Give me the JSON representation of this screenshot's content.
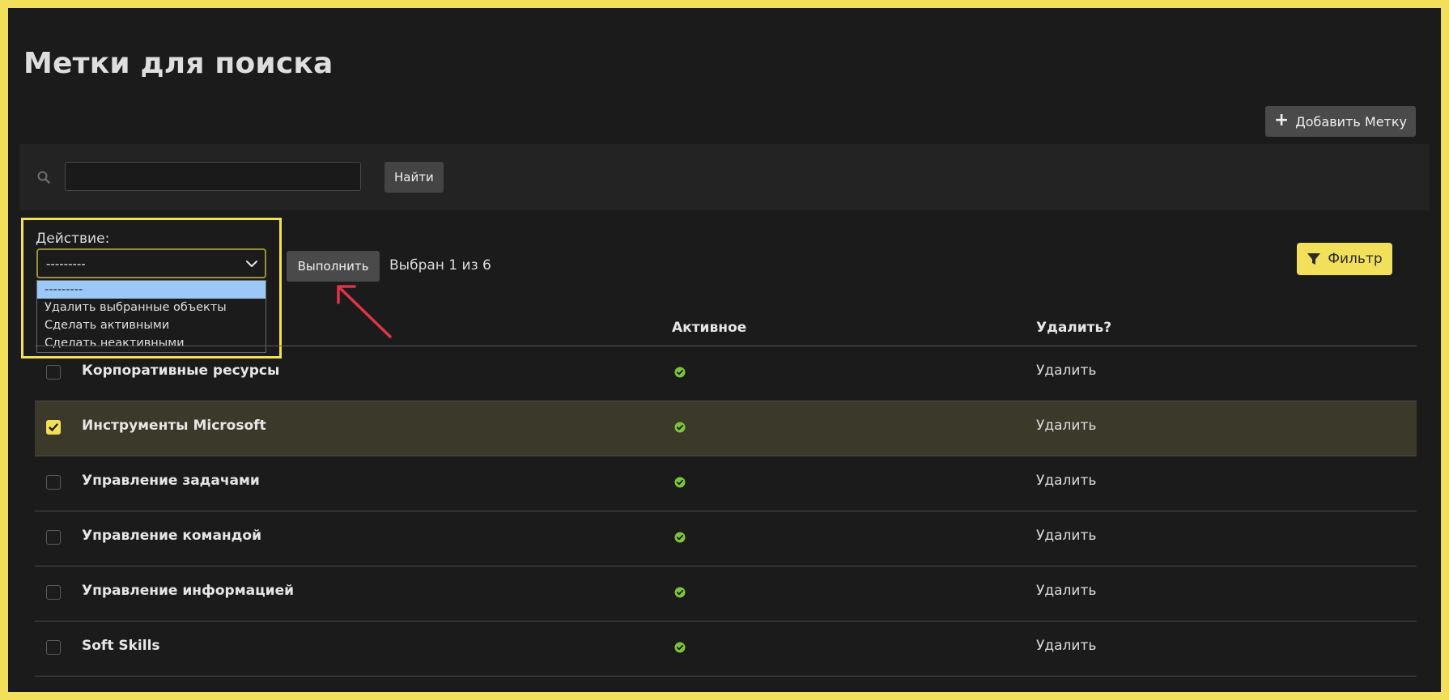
{
  "page": {
    "title": "Метки для поиска"
  },
  "toolbar": {
    "add_label": "Добавить Метку"
  },
  "search": {
    "value": "",
    "placeholder": "",
    "button_label": "Найти"
  },
  "actions": {
    "label": "Действие:",
    "selected_value": "---------",
    "options": [
      "---------",
      "Удалить выбранные объекты",
      "Сделать активными",
      "Сделать неактивными"
    ],
    "run_label": "Выполнить",
    "selected_count": "Выбран 1 из 6"
  },
  "filter": {
    "label": "Фильтр"
  },
  "table": {
    "headers": {
      "active": "Активное",
      "delete": "Удалить?"
    },
    "rows": [
      {
        "name": "Корпоративные ресурсы",
        "checked": false,
        "active": true,
        "delete_label": "Удалить"
      },
      {
        "name": "Инструменты Microsoft",
        "checked": true,
        "active": true,
        "delete_label": "Удалить"
      },
      {
        "name": "Управление задачами",
        "checked": false,
        "active": true,
        "delete_label": "Удалить"
      },
      {
        "name": "Управление командой",
        "checked": false,
        "active": true,
        "delete_label": "Удалить"
      },
      {
        "name": "Управление информацией",
        "checked": false,
        "active": true,
        "delete_label": "Удалить"
      },
      {
        "name": "Soft Skills",
        "checked": false,
        "active": true,
        "delete_label": "Удалить"
      }
    ]
  },
  "colors": {
    "accent": "#f3e05a",
    "active_ok": "#7cc33a",
    "annotation_arrow": "#e0334a",
    "selected_row": "#3b392a"
  },
  "icons": {
    "search": "search-icon",
    "filter": "filter-icon",
    "check": "check-circle-icon",
    "plus": "plus-icon",
    "chevron": "chevron-down-icon"
  }
}
